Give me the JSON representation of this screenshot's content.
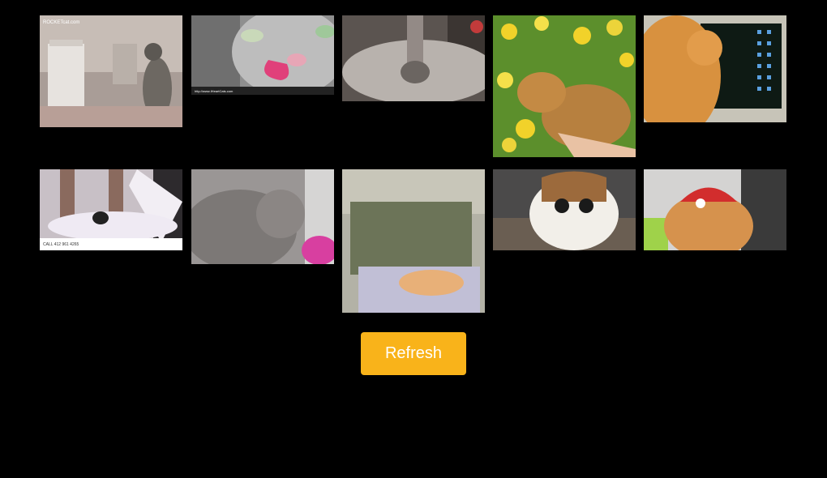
{
  "gallery": {
    "items": [
      {
        "subject": "tabby cat standing by humidifier",
        "watermark": "ROCKETcat.com"
      },
      {
        "subject": "grey tabby cat licking with pink tongue",
        "watermark": "http://www.IHeartCats.com"
      },
      {
        "subject": "grey cat paws up on sofa",
        "watermark": ""
      },
      {
        "subject": "bengal kitten among yellow flowers",
        "watermark": ""
      },
      {
        "subject": "orange cat looking at computer monitor",
        "watermark": ""
      },
      {
        "subject": "kitten hiding in cat scratching post",
        "watermark": "CALL 412 961 4265"
      },
      {
        "subject": "grey fluffy kitten by pink bowl",
        "watermark": ""
      },
      {
        "subject": "orange cat sleeping on couch",
        "watermark": ""
      },
      {
        "subject": "white and brown cat with big eyes",
        "watermark": ""
      },
      {
        "subject": "ginger persian cat wearing santa hat",
        "watermark": ""
      }
    ]
  },
  "controls": {
    "refresh_label": "Refresh",
    "refresh_color": "#f9b31a"
  }
}
